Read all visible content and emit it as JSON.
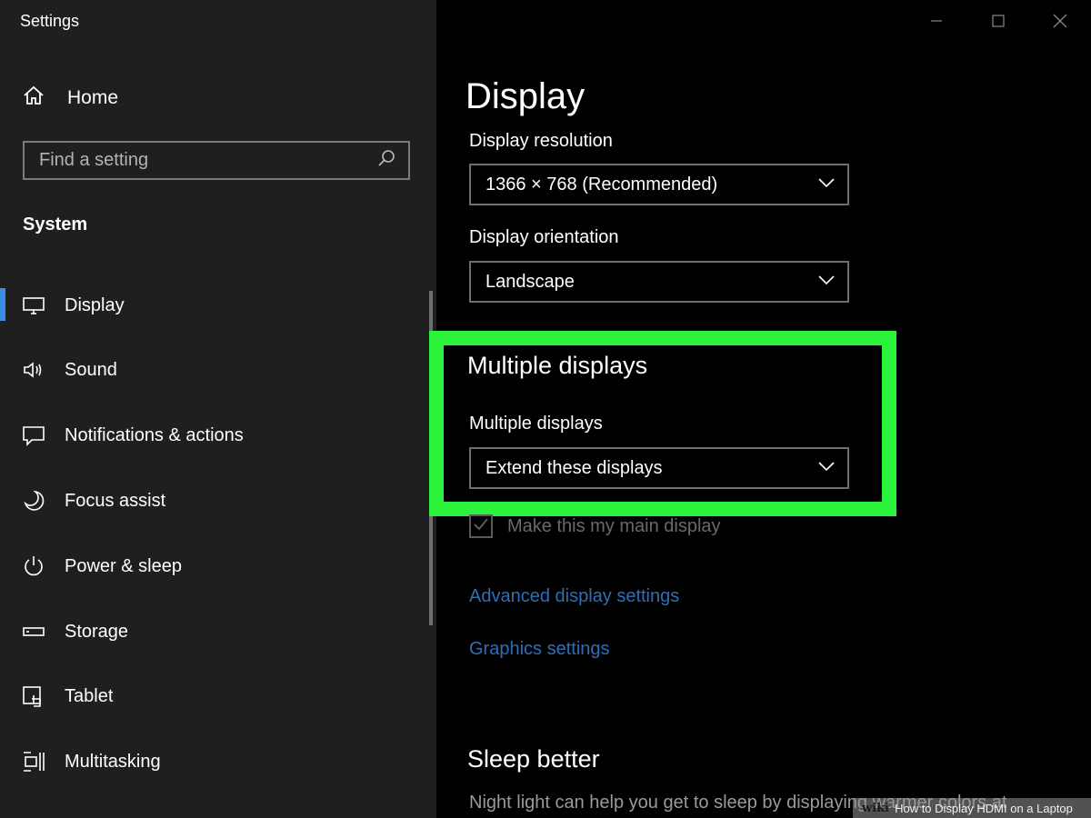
{
  "window": {
    "title": "Settings",
    "controls": [
      "minimize-icon",
      "maximize-icon",
      "close-icon"
    ]
  },
  "sidebar": {
    "home_label": "Home",
    "search": {
      "placeholder": "Find a setting"
    },
    "section_label": "System",
    "items": [
      {
        "label": "Display",
        "icon": "monitor-icon",
        "active": true
      },
      {
        "label": "Sound",
        "icon": "speaker-icon"
      },
      {
        "label": "Notifications & actions",
        "icon": "notification-icon"
      },
      {
        "label": "Focus assist",
        "icon": "moon-icon"
      },
      {
        "label": "Power & sleep",
        "icon": "power-icon"
      },
      {
        "label": "Storage",
        "icon": "storage-icon"
      },
      {
        "label": "Tablet",
        "icon": "tablet-icon"
      },
      {
        "label": "Multitasking",
        "icon": "multitasking-icon"
      }
    ]
  },
  "main": {
    "title": "Display",
    "resolution": {
      "label": "Display resolution",
      "value": "1366 × 768 (Recommended)"
    },
    "orientation": {
      "label": "Display orientation",
      "value": "Landscape"
    },
    "multiple_displays": {
      "heading": "Multiple displays",
      "label": "Multiple displays",
      "value": "Extend these displays"
    },
    "main_display_checkbox": {
      "label": "Make this my main display",
      "checked": true
    },
    "links": {
      "advanced": "Advanced display settings",
      "graphics": "Graphics settings"
    },
    "sleep": {
      "heading": "Sleep better",
      "text": "Night light can help you get to sleep by displaying warmer colors at"
    }
  },
  "watermark": {
    "brand": "wiki",
    "text": "How to Display HDMI on a Laptop"
  },
  "colors": {
    "accent": "#3a8ee6",
    "highlight": "#2bf23b",
    "link": "#2e6fb8",
    "sidebar_bg": "#1f1f1f"
  }
}
